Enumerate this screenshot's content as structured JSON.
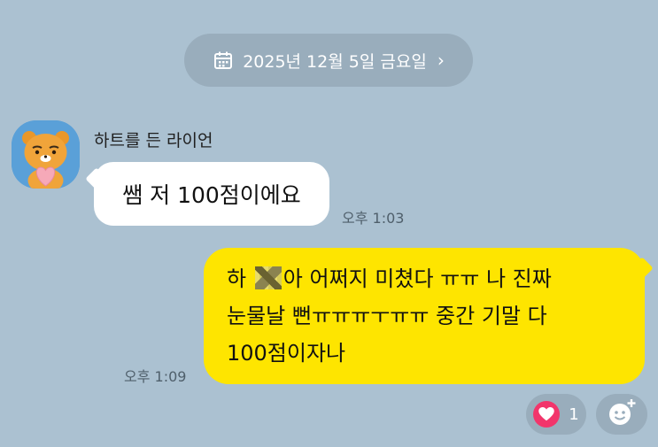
{
  "date_divider": {
    "label": "2025년 12월 5일 금요일",
    "icon": "calendar-icon",
    "chevron": "›"
  },
  "incoming": {
    "sender_name": "하트를 든 라이언",
    "avatar_icon": "ryan-heart-avatar",
    "message": "쌤 저 100점이에요",
    "time": "오후 1:03"
  },
  "outgoing": {
    "line1_start": "하",
    "line1_end": "아 어쩌지 미쳤다 ㅠㅠ 나 진짜",
    "line2": "눈물날 뻔ㅠㅠㅠㅜㅠㅠ 중간 기말 다",
    "line3": "100점이자나",
    "time": "오후 1:09"
  },
  "reactions": {
    "heart_count": "1",
    "heart_icon": "heart-icon",
    "add_icon": "add-reaction-icon"
  },
  "colors": {
    "background": "#abc1d1",
    "pill": "#99adbc",
    "incoming_bubble": "#ffffff",
    "outgoing_bubble": "#fee500",
    "heart": "#f2356b"
  }
}
